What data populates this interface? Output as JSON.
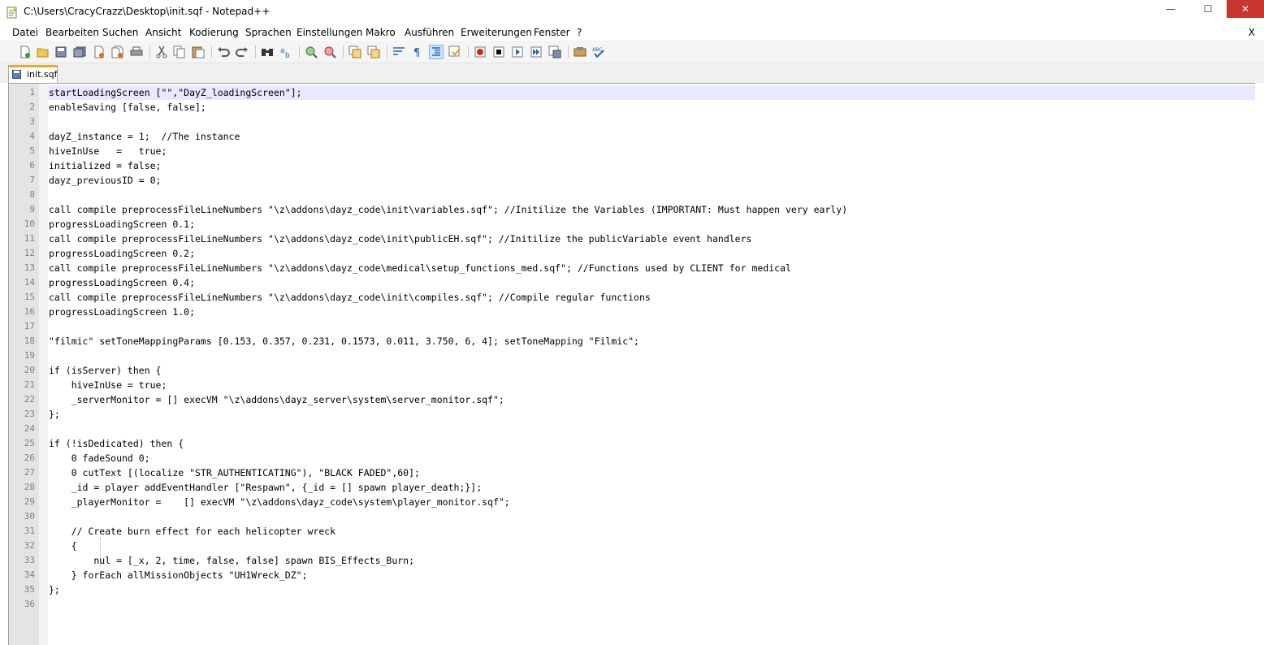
{
  "window": {
    "title": "C:\\Users\\CracyCrazz\\Desktop\\init.sqf - Notepad++",
    "minimize": "—",
    "maximize": "☐",
    "close": "✕"
  },
  "menu": {
    "items": [
      "Datei",
      "Bearbeiten",
      "Suchen",
      "Ansicht",
      "Kodierung",
      "Sprachen",
      "Einstellungen",
      "Makro",
      "Ausführen",
      "Erweiterungen",
      "Fenster",
      "?"
    ],
    "close_doc": "X"
  },
  "toolbar": {
    "icons": [
      "new-file",
      "open-file",
      "save",
      "save-all",
      "close",
      "close-all",
      "print",
      "cut",
      "copy",
      "paste",
      "undo",
      "redo",
      "find",
      "replace",
      "zoom-in",
      "zoom-out",
      "sync-vertical",
      "sync-horizontal",
      "word-wrap",
      "show-all-chars",
      "indent-guide",
      "folder-as-workspace",
      "record-macro",
      "stop-record",
      "play-macro",
      "run-macro-multiple",
      "save-macro",
      "doc-map",
      "spell-check"
    ],
    "active": "indent-guide"
  },
  "tabs": [
    {
      "label": "init.sqf"
    }
  ],
  "editor": {
    "current_line": 1,
    "lines": [
      {
        "n": "1",
        "text": "startLoadingScreen [\"\",\"DayZ_loadingScreen\"];"
      },
      {
        "n": "2",
        "text": "enableSaving [false, false];"
      },
      {
        "n": "3",
        "text": ""
      },
      {
        "n": "4",
        "text": "dayZ_instance = 1;  //The instance"
      },
      {
        "n": "5",
        "text": "hiveInUse   =   true;"
      },
      {
        "n": "6",
        "text": "initialized = false;"
      },
      {
        "n": "7",
        "text": "dayz_previousID = 0;"
      },
      {
        "n": "8",
        "text": ""
      },
      {
        "n": "9",
        "text": "call compile preprocessFileLineNumbers \"\\z\\addons\\dayz_code\\init\\variables.sqf\"; //Initilize the Variables (IMPORTANT: Must happen very early)"
      },
      {
        "n": "10",
        "text": "progressLoadingScreen 0.1;"
      },
      {
        "n": "11",
        "text": "call compile preprocessFileLineNumbers \"\\z\\addons\\dayz_code\\init\\publicEH.sqf\"; //Initilize the publicVariable event handlers"
      },
      {
        "n": "12",
        "text": "progressLoadingScreen 0.2;"
      },
      {
        "n": "13",
        "text": "call compile preprocessFileLineNumbers \"\\z\\addons\\dayz_code\\medical\\setup_functions_med.sqf\"; //Functions used by CLIENT for medical"
      },
      {
        "n": "14",
        "text": "progressLoadingScreen 0.4;"
      },
      {
        "n": "15",
        "text": "call compile preprocessFileLineNumbers \"\\z\\addons\\dayz_code\\init\\compiles.sqf\"; //Compile regular functions"
      },
      {
        "n": "16",
        "text": "progressLoadingScreen 1.0;"
      },
      {
        "n": "17",
        "text": ""
      },
      {
        "n": "18",
        "text": "\"filmic\" setToneMappingParams [0.153, 0.357, 0.231, 0.1573, 0.011, 3.750, 6, 4]; setToneMapping \"Filmic\";"
      },
      {
        "n": "19",
        "text": ""
      },
      {
        "n": "20",
        "text": "if (isServer) then {"
      },
      {
        "n": "21",
        "text": "    hiveInUse = true;"
      },
      {
        "n": "22",
        "text": "    _serverMonitor = [] execVM \"\\z\\addons\\dayz_server\\system\\server_monitor.sqf\";"
      },
      {
        "n": "23",
        "text": "};"
      },
      {
        "n": "24",
        "text": ""
      },
      {
        "n": "25",
        "text": "if (!isDedicated) then {"
      },
      {
        "n": "26",
        "text": "    0 fadeSound 0;"
      },
      {
        "n": "27",
        "text": "    0 cutText [(localize \"STR_AUTHENTICATING\"), \"BLACK FADED\",60];"
      },
      {
        "n": "28",
        "text": "    _id = player addEventHandler [\"Respawn\", {_id = [] spawn player_death;}];"
      },
      {
        "n": "29",
        "text": "    _playerMonitor =    [] execVM \"\\z\\addons\\dayz_code\\system\\player_monitor.sqf\";"
      },
      {
        "n": "30",
        "text": ""
      },
      {
        "n": "31",
        "text": "    // Create burn effect for each helicopter wreck"
      },
      {
        "n": "32",
        "text": "    {"
      },
      {
        "n": "33",
        "text": "        nul = [_x, 2, time, false, false] spawn BIS_Effects_Burn;"
      },
      {
        "n": "34",
        "text": "    } forEach allMissionObjects \"UH1Wreck_DZ\";"
      },
      {
        "n": "35",
        "text": "};"
      },
      {
        "n": "36",
        "text": ""
      }
    ]
  }
}
